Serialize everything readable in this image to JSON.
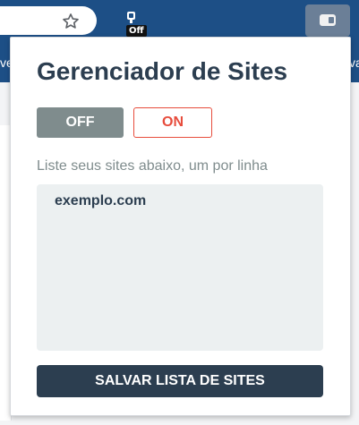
{
  "browser": {
    "extension_badge": "Off",
    "left_fragment": "ve",
    "right_fragment": "va"
  },
  "popup": {
    "title": "Gerenciador de Sites",
    "off_button": "OFF",
    "on_button": "ON",
    "instruction": "Liste seus sites abaixo, um por linha",
    "sites_text": "exemplo.com",
    "save_button": "SALVAR LISTA DE SITES"
  },
  "icons": {
    "star": "star-icon",
    "extension": "extension-icon",
    "toggle": "toggle-icon"
  },
  "colors": {
    "title": "#2c3e50",
    "off_button_bg": "#7f8c8d",
    "on_button_accent": "#e74c3c",
    "textarea_bg": "#ecf0f1",
    "save_button_bg": "#2c3e50",
    "browser_bar": "#1d4f86"
  }
}
